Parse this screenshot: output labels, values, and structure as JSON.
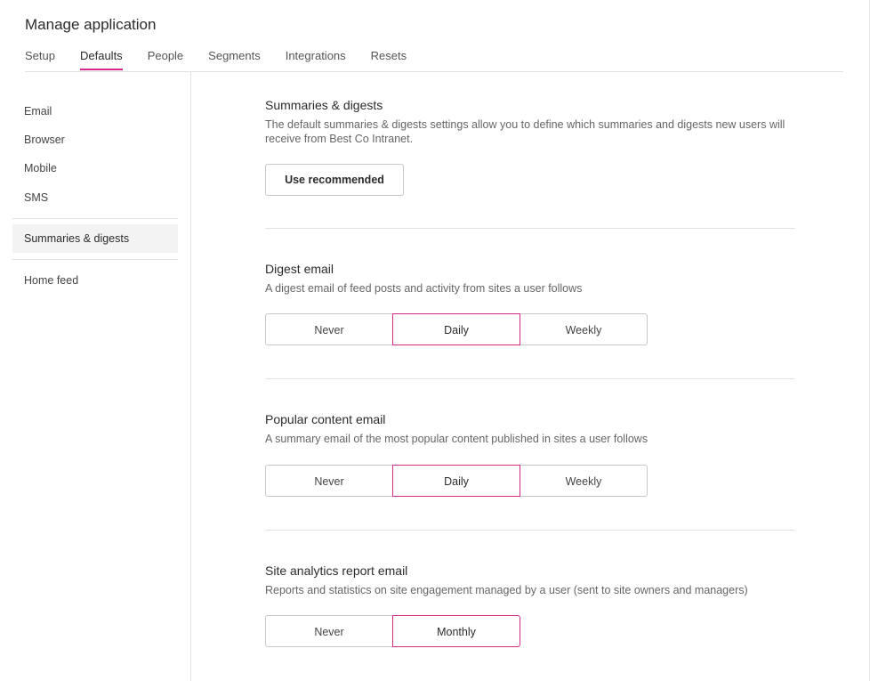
{
  "header": {
    "title": "Manage application"
  },
  "tabs": [
    {
      "label": "Setup"
    },
    {
      "label": "Defaults"
    },
    {
      "label": "People"
    },
    {
      "label": "Segments"
    },
    {
      "label": "Integrations"
    },
    {
      "label": "Resets"
    }
  ],
  "active_tab": "Defaults",
  "sidebar": {
    "items": [
      {
        "label": "Email"
      },
      {
        "label": "Browser"
      },
      {
        "label": "Mobile"
      },
      {
        "label": "SMS"
      },
      {
        "label": "Summaries & digests"
      },
      {
        "label": "Home feed"
      }
    ],
    "active": "Summaries & digests"
  },
  "main": {
    "intro": {
      "title": "Summaries & digests",
      "description": "The default summaries & digests settings allow you to define which summaries and digests new users will receive from Best Co Intranet.",
      "button_label": "Use recommended"
    },
    "digest_email": {
      "title": "Digest email",
      "description": "A digest email of feed posts and activity from sites a user follows",
      "options": [
        "Never",
        "Daily",
        "Weekly"
      ],
      "selected": "Daily"
    },
    "popular_content_email": {
      "title": "Popular content email",
      "description": "A summary email of the most popular content published in sites a user follows",
      "options": [
        "Never",
        "Daily",
        "Weekly"
      ],
      "selected": "Daily"
    },
    "site_analytics_email": {
      "title": "Site analytics report email",
      "description": "Reports and statistics on site engagement managed by a user (sent to site owners and managers)",
      "options": [
        "Never",
        "Monthly"
      ],
      "selected": "Monthly"
    }
  },
  "colors": {
    "accent": "#d6298c",
    "border": "#c8c8c8",
    "divider": "#e2e2e2",
    "active_bg": "#f3f3f3"
  }
}
